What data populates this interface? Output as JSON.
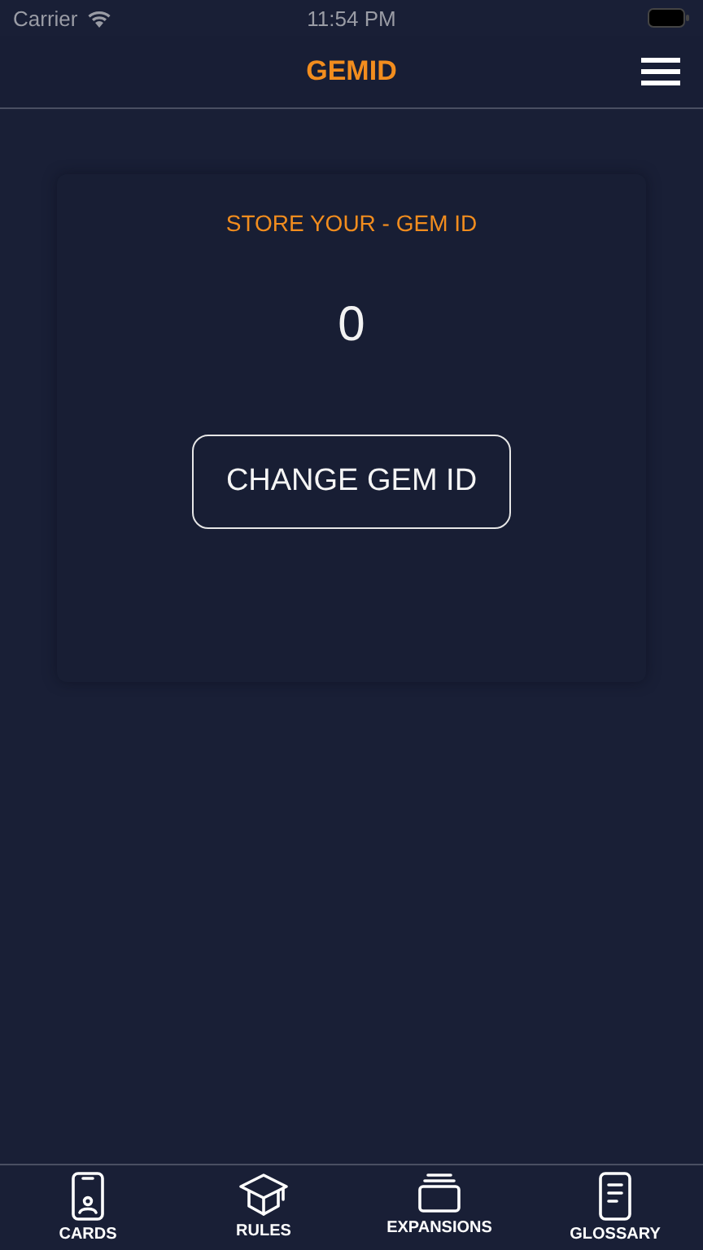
{
  "status_bar": {
    "carrier": "Carrier",
    "time": "11:54 PM"
  },
  "nav_bar": {
    "title": "GEMID"
  },
  "card": {
    "heading": "STORE YOUR - GEM ID",
    "value": "0",
    "button": "CHANGE GEM ID"
  },
  "tab_bar": [
    {
      "label": "CARDS",
      "kind": "phone"
    },
    {
      "label": "RULES",
      "kind": "cap"
    },
    {
      "label": "EXPANSIONS",
      "kind": "stack"
    },
    {
      "label": "GLOSSARY",
      "kind": "doc"
    }
  ]
}
